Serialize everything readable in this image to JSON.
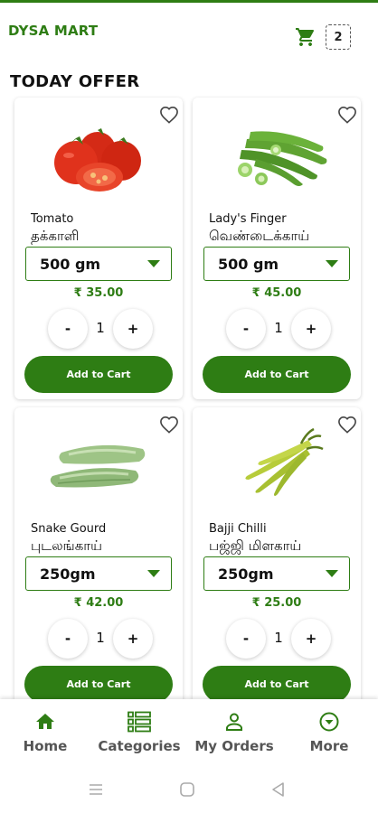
{
  "app": {
    "title": "DYSA MART",
    "accent_color": "#2e7d14",
    "cart_icon": "cart-icon",
    "cart_count": "2"
  },
  "main": {
    "section_title": "TODAY OFFER",
    "add_to_cart_label": "Add to Cart",
    "minus_label": "-",
    "plus_label": "+",
    "products": [
      {
        "name": "Tomato",
        "name_ta": "தக்காளி",
        "quantity_option": "500 gm",
        "price": "₹ 35.00",
        "count": "1",
        "image": "tomato",
        "favorite_icon": "heart-outline-icon"
      },
      {
        "name": "Lady's Finger",
        "name_ta": "வெண்டைக்காய்",
        "quantity_option": "500 gm",
        "price": "₹ 45.00",
        "count": "1",
        "image": "ladys-finger",
        "favorite_icon": "heart-outline-icon"
      },
      {
        "name": "Snake Gourd",
        "name_ta": "புடலங்காய்",
        "quantity_option": "250gm",
        "price": "₹ 42.00",
        "count": "1",
        "image": "snake-gourd",
        "favorite_icon": "heart-outline-icon"
      },
      {
        "name": "Bajji Chilli",
        "name_ta": "பஜ்ஜி மிளகாய்",
        "quantity_option": "250gm",
        "price": "₹ 25.00",
        "count": "1",
        "image": "bajji-chilli",
        "favorite_icon": "heart-outline-icon"
      }
    ]
  },
  "bottom_nav": {
    "items": [
      {
        "label": "Home",
        "icon": "home-icon",
        "active": true
      },
      {
        "label": "Categories",
        "icon": "categories-icon",
        "active": false
      },
      {
        "label": "My Orders",
        "icon": "person-icon",
        "active": false
      },
      {
        "label": "More",
        "icon": "more-icon",
        "active": false
      }
    ]
  },
  "system_nav": {
    "buttons": [
      "recents-icon",
      "home-circle-icon",
      "back-icon"
    ]
  }
}
